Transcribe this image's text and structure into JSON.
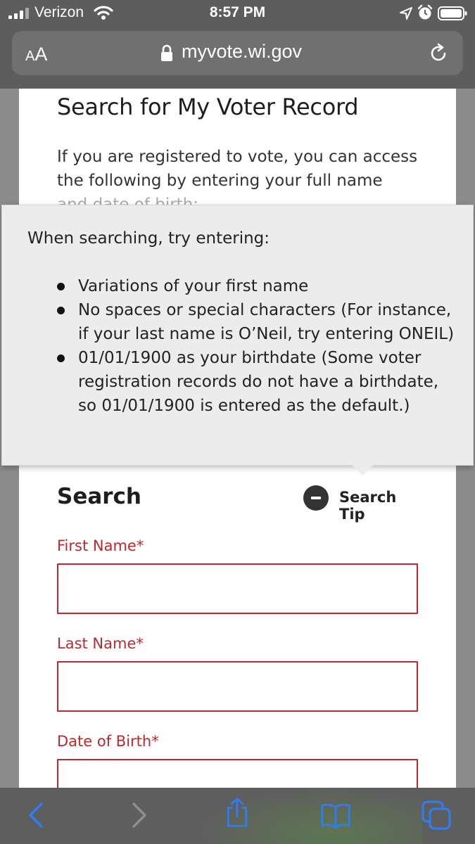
{
  "status_bar": {
    "carrier": "Verizon",
    "time": "8:57 PM"
  },
  "browser": {
    "text_size_small": "A",
    "text_size_big": "A",
    "url": "myvote.wi.gov"
  },
  "page": {
    "title": "Search for My Voter Record",
    "intro": "If you are registered to vote, you can access the following by entering your full name",
    "intro_cut": "and date of birth:"
  },
  "tooltip": {
    "heading": "When searching, try entering:",
    "items": [
      "Variations of your first name",
      "No spaces or special characters (For instance, if your last name is O’Neil, try entering ONEIL)",
      "01/01/1900 as your birthdate (Some voter registration records do not have a birthdate, so 01/01/1900 is entered as the default.)"
    ]
  },
  "search": {
    "heading": "Search",
    "tip_label": "Search Tip",
    "fields": {
      "first_name": {
        "label": "First Name*",
        "value": ""
      },
      "last_name": {
        "label": "Last Name*",
        "value": ""
      },
      "dob": {
        "label": "Date of Birth*",
        "value": ""
      }
    }
  },
  "colors": {
    "required_red": "#c1272d",
    "chrome_gray": "#5d5d5d",
    "toolbar_blue": "#2f7df6"
  },
  "icons": [
    "signal-icon",
    "wifi-icon",
    "location-icon",
    "alarm-icon",
    "battery-icon",
    "lock-icon",
    "reload-icon",
    "back-icon",
    "forward-icon",
    "share-icon",
    "bookmarks-icon",
    "tabs-icon"
  ]
}
